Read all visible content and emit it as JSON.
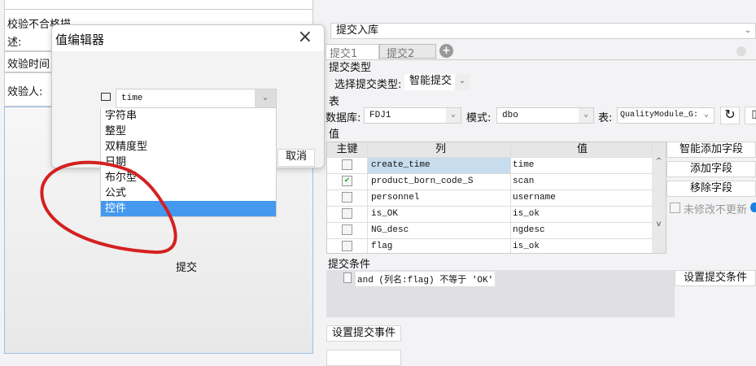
{
  "left_form": {
    "rows": [
      {
        "label": "校验不合格描述:"
      },
      {
        "label": "效验时间"
      },
      {
        "label": "效验人:"
      }
    ],
    "canvas_label": "提交"
  },
  "dialog": {
    "title": "值编辑器",
    "close": "×",
    "type_value": "time",
    "cancel": "取消",
    "options": [
      "字符串",
      "整型",
      "双精度型",
      "日期",
      "布尔型",
      "公式",
      "控件"
    ],
    "selected": "控件"
  },
  "right": {
    "action_select": "提交入库",
    "tabs": [
      "提交1",
      "提交2"
    ],
    "submit_type_section": "提交类型",
    "submit_type_label": "选择提交类型:",
    "submit_type_value": "智能提交",
    "table_section": "表",
    "db_label": "数据库:",
    "db_value": "FDJ1",
    "schema_label": "模式:",
    "schema_value": "dbo",
    "table_label": "表:",
    "table_value": "QualityModule_G:",
    "value_section": "值",
    "grid": {
      "headers": [
        "主键",
        "列",
        "值"
      ],
      "rows": [
        {
          "pk": false,
          "col": "create_time",
          "val": "time"
        },
        {
          "pk": true,
          "col": "product_born_code_S",
          "val": "scan"
        },
        {
          "pk": false,
          "col": "personnel",
          "val": "username"
        },
        {
          "pk": false,
          "col": "is_OK",
          "val": "is_ok"
        },
        {
          "pk": false,
          "col": "NG_desc",
          "val": "ngdesc"
        },
        {
          "pk": false,
          "col": "flag",
          "val": "is_ok"
        }
      ]
    },
    "buttons": {
      "smart_add": "智能添加字段",
      "add": "添加字段",
      "remove": "移除字段",
      "no_update": "未修改不更新"
    },
    "condition_section": "提交条件",
    "condition": "and (列名:flag) 不等于 'OK'",
    "set_condition": "设置提交条件",
    "set_event": "设置提交事件"
  },
  "colors": {
    "selected": "#4499ee",
    "annotation": "#d42020"
  }
}
